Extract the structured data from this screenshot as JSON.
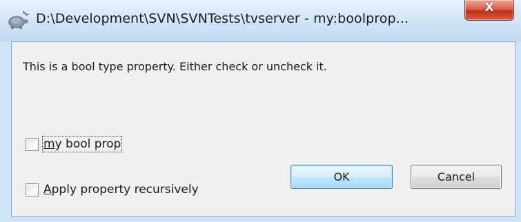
{
  "window": {
    "title": "D:\\Development\\SVN\\SVNTests\\tvserver - my:boolprop...",
    "icon": "tortoisesvn-icon",
    "close_glyph": "X"
  },
  "dialog": {
    "description": "This is a bool type property. Either check or uncheck it.",
    "bool_checkbox": {
      "label": "my bool prop",
      "checked": false
    },
    "recursive_checkbox": {
      "label": "Apply property recursively",
      "checked": false
    },
    "ok_label": "OK",
    "cancel_label": "Cancel"
  },
  "colors": {
    "frame": "#cfe3f6",
    "client_bg": "#f0f0f0",
    "close_red": "#c0311b",
    "ok_border": "#3c7fb1"
  }
}
